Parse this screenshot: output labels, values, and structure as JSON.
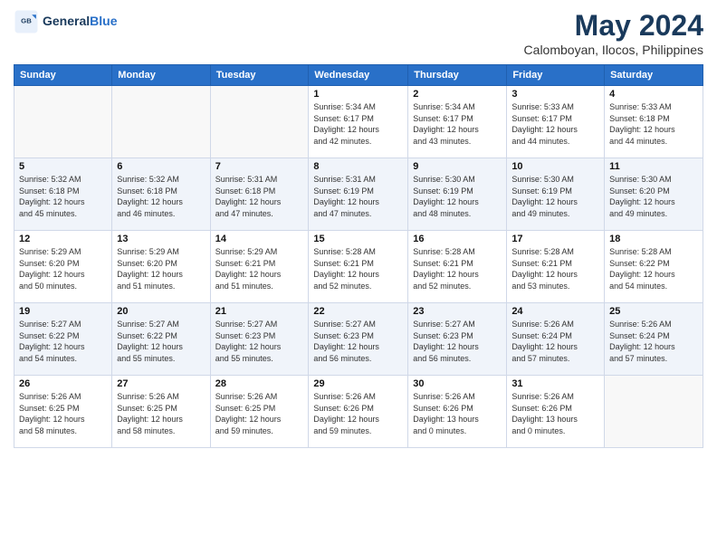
{
  "logo": {
    "line1": "General",
    "line2": "Blue"
  },
  "header": {
    "month": "May 2024",
    "location": "Calomboyan, Ilocos, Philippines"
  },
  "weekdays": [
    "Sunday",
    "Monday",
    "Tuesday",
    "Wednesday",
    "Thursday",
    "Friday",
    "Saturday"
  ],
  "weeks": [
    [
      {
        "day": "",
        "info": ""
      },
      {
        "day": "",
        "info": ""
      },
      {
        "day": "",
        "info": ""
      },
      {
        "day": "1",
        "info": "Sunrise: 5:34 AM\nSunset: 6:17 PM\nDaylight: 12 hours\nand 42 minutes."
      },
      {
        "day": "2",
        "info": "Sunrise: 5:34 AM\nSunset: 6:17 PM\nDaylight: 12 hours\nand 43 minutes."
      },
      {
        "day": "3",
        "info": "Sunrise: 5:33 AM\nSunset: 6:17 PM\nDaylight: 12 hours\nand 44 minutes."
      },
      {
        "day": "4",
        "info": "Sunrise: 5:33 AM\nSunset: 6:18 PM\nDaylight: 12 hours\nand 44 minutes."
      }
    ],
    [
      {
        "day": "5",
        "info": "Sunrise: 5:32 AM\nSunset: 6:18 PM\nDaylight: 12 hours\nand 45 minutes."
      },
      {
        "day": "6",
        "info": "Sunrise: 5:32 AM\nSunset: 6:18 PM\nDaylight: 12 hours\nand 46 minutes."
      },
      {
        "day": "7",
        "info": "Sunrise: 5:31 AM\nSunset: 6:18 PM\nDaylight: 12 hours\nand 47 minutes."
      },
      {
        "day": "8",
        "info": "Sunrise: 5:31 AM\nSunset: 6:19 PM\nDaylight: 12 hours\nand 47 minutes."
      },
      {
        "day": "9",
        "info": "Sunrise: 5:30 AM\nSunset: 6:19 PM\nDaylight: 12 hours\nand 48 minutes."
      },
      {
        "day": "10",
        "info": "Sunrise: 5:30 AM\nSunset: 6:19 PM\nDaylight: 12 hours\nand 49 minutes."
      },
      {
        "day": "11",
        "info": "Sunrise: 5:30 AM\nSunset: 6:20 PM\nDaylight: 12 hours\nand 49 minutes."
      }
    ],
    [
      {
        "day": "12",
        "info": "Sunrise: 5:29 AM\nSunset: 6:20 PM\nDaylight: 12 hours\nand 50 minutes."
      },
      {
        "day": "13",
        "info": "Sunrise: 5:29 AM\nSunset: 6:20 PM\nDaylight: 12 hours\nand 51 minutes."
      },
      {
        "day": "14",
        "info": "Sunrise: 5:29 AM\nSunset: 6:21 PM\nDaylight: 12 hours\nand 51 minutes."
      },
      {
        "day": "15",
        "info": "Sunrise: 5:28 AM\nSunset: 6:21 PM\nDaylight: 12 hours\nand 52 minutes."
      },
      {
        "day": "16",
        "info": "Sunrise: 5:28 AM\nSunset: 6:21 PM\nDaylight: 12 hours\nand 52 minutes."
      },
      {
        "day": "17",
        "info": "Sunrise: 5:28 AM\nSunset: 6:21 PM\nDaylight: 12 hours\nand 53 minutes."
      },
      {
        "day": "18",
        "info": "Sunrise: 5:28 AM\nSunset: 6:22 PM\nDaylight: 12 hours\nand 54 minutes."
      }
    ],
    [
      {
        "day": "19",
        "info": "Sunrise: 5:27 AM\nSunset: 6:22 PM\nDaylight: 12 hours\nand 54 minutes."
      },
      {
        "day": "20",
        "info": "Sunrise: 5:27 AM\nSunset: 6:22 PM\nDaylight: 12 hours\nand 55 minutes."
      },
      {
        "day": "21",
        "info": "Sunrise: 5:27 AM\nSunset: 6:23 PM\nDaylight: 12 hours\nand 55 minutes."
      },
      {
        "day": "22",
        "info": "Sunrise: 5:27 AM\nSunset: 6:23 PM\nDaylight: 12 hours\nand 56 minutes."
      },
      {
        "day": "23",
        "info": "Sunrise: 5:27 AM\nSunset: 6:23 PM\nDaylight: 12 hours\nand 56 minutes."
      },
      {
        "day": "24",
        "info": "Sunrise: 5:26 AM\nSunset: 6:24 PM\nDaylight: 12 hours\nand 57 minutes."
      },
      {
        "day": "25",
        "info": "Sunrise: 5:26 AM\nSunset: 6:24 PM\nDaylight: 12 hours\nand 57 minutes."
      }
    ],
    [
      {
        "day": "26",
        "info": "Sunrise: 5:26 AM\nSunset: 6:25 PM\nDaylight: 12 hours\nand 58 minutes."
      },
      {
        "day": "27",
        "info": "Sunrise: 5:26 AM\nSunset: 6:25 PM\nDaylight: 12 hours\nand 58 minutes."
      },
      {
        "day": "28",
        "info": "Sunrise: 5:26 AM\nSunset: 6:25 PM\nDaylight: 12 hours\nand 59 minutes."
      },
      {
        "day": "29",
        "info": "Sunrise: 5:26 AM\nSunset: 6:26 PM\nDaylight: 12 hours\nand 59 minutes."
      },
      {
        "day": "30",
        "info": "Sunrise: 5:26 AM\nSunset: 6:26 PM\nDaylight: 13 hours\nand 0 minutes."
      },
      {
        "day": "31",
        "info": "Sunrise: 5:26 AM\nSunset: 6:26 PM\nDaylight: 13 hours\nand 0 minutes."
      },
      {
        "day": "",
        "info": ""
      }
    ]
  ]
}
